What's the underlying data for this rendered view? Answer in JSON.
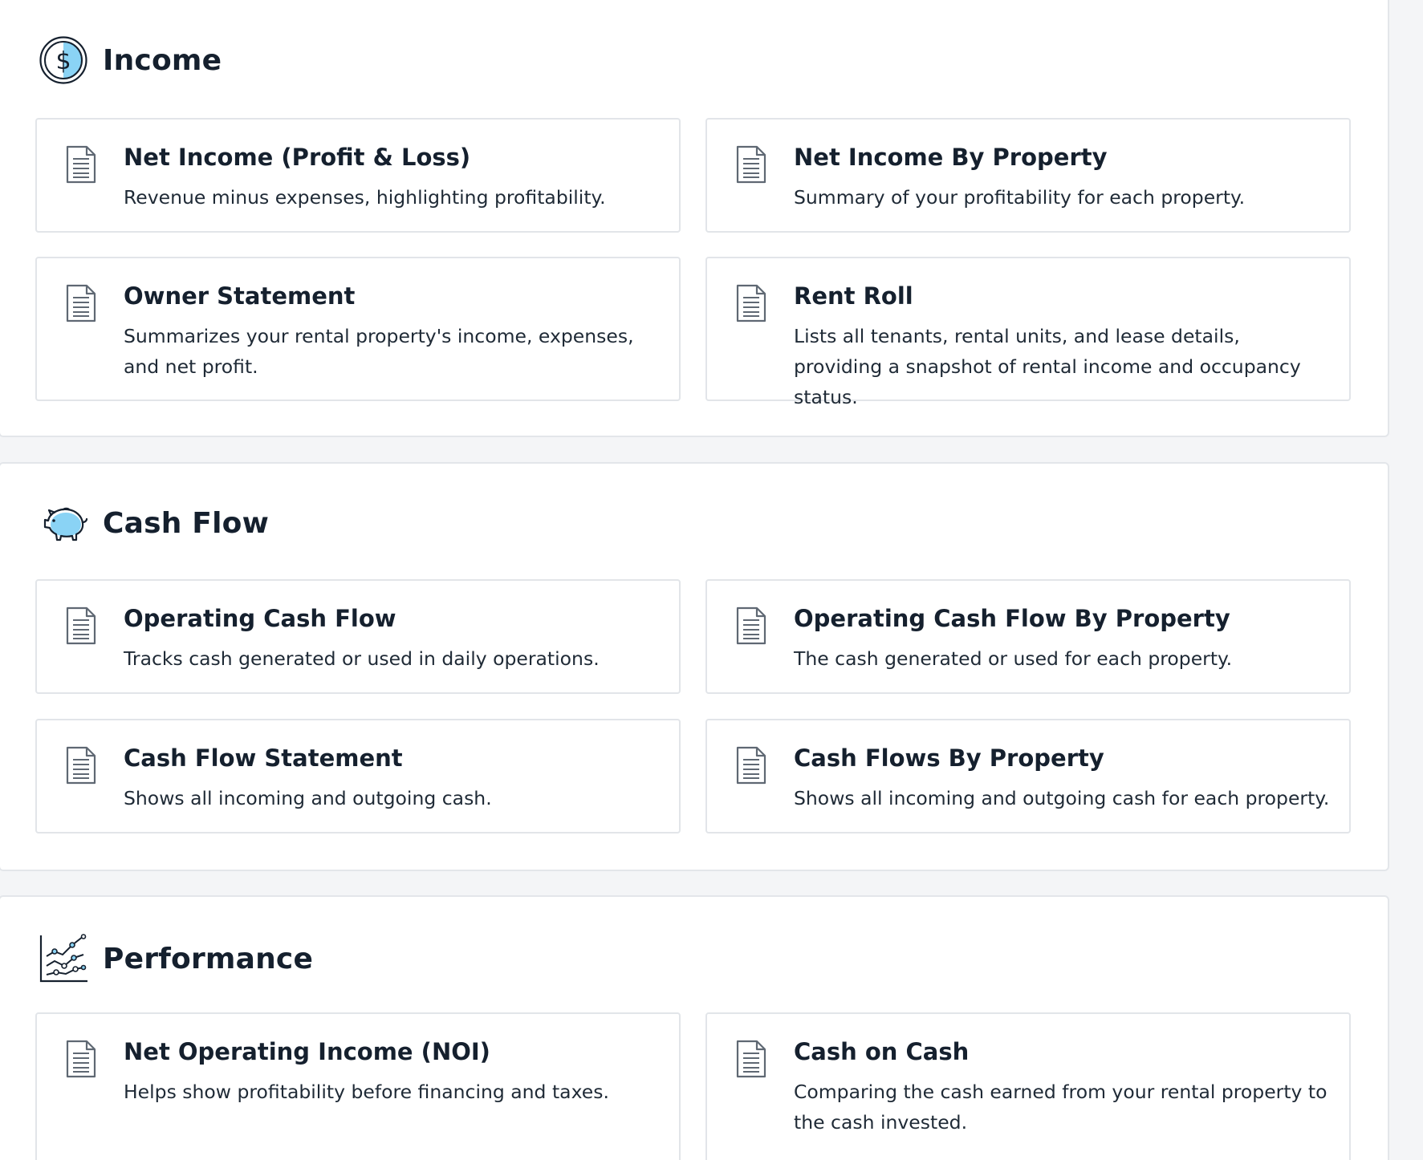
{
  "sections": [
    {
      "title": "Income",
      "icon": "dollar-coin-icon",
      "cards": [
        {
          "title": "Net Income (Profit & Loss)",
          "description": "Revenue minus expenses, highlighting profitability."
        },
        {
          "title": "Net Income By Property",
          "description": "Summary of your profitability for each property."
        },
        {
          "title": "Owner Statement",
          "description": "Summarizes your rental property's income, expenses, and net profit."
        },
        {
          "title": "Rent Roll",
          "description": "Lists all tenants, rental units, and lease details, providing a snapshot of rental income and occupancy status."
        }
      ]
    },
    {
      "title": "Cash Flow",
      "icon": "piggy-bank-icon",
      "cards": [
        {
          "title": "Operating Cash Flow",
          "description": "Tracks cash generated or used in daily operations."
        },
        {
          "title": "Operating Cash Flow By Property",
          "description": "The cash generated or used for each property."
        },
        {
          "title": "Cash Flow Statement",
          "description": "Shows all incoming and outgoing cash."
        },
        {
          "title": "Cash Flows By Property",
          "description": "Shows all incoming and outgoing cash for each property."
        }
      ]
    },
    {
      "title": "Performance",
      "icon": "line-chart-icon",
      "cards": [
        {
          "title": "Net Operating Income (NOI)",
          "description": "Helps show profitability before financing and taxes."
        },
        {
          "title": "Cash on Cash",
          "description": "Comparing the cash earned from your rental property to the cash invested."
        }
      ]
    }
  ],
  "colors": {
    "accent": "#7dd3fc",
    "text": "#15202e",
    "border": "#e2e5e9",
    "background": "#f4f5f7"
  },
  "card_icon": "document-icon"
}
